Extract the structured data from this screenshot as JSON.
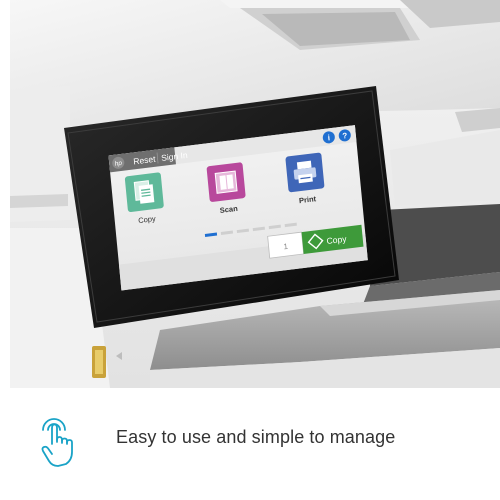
{
  "screen": {
    "brand": "hp",
    "top_buttons": [
      "Reset",
      "Sign In"
    ],
    "info_icon": "info-icon",
    "help_icon": "help-icon",
    "apps": [
      {
        "label": "Copy",
        "icon": "copy-icon",
        "color": "#5fb99a"
      },
      {
        "label": "Scan",
        "icon": "scan-icon",
        "color": "#b8489c"
      },
      {
        "label": "Print",
        "icon": "print-icon",
        "color": "#3f66b8"
      }
    ],
    "page_indicator": {
      "pages": 6,
      "current": 1
    },
    "copies_value": "1",
    "copy_button_label": "Copy"
  },
  "caption": {
    "text": "Easy to use and simple to manage",
    "icon": "touch-hand-icon",
    "accent_color": "#1aa3c7"
  }
}
